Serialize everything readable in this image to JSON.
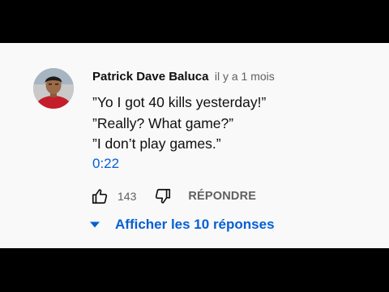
{
  "comment": {
    "author": "Patrick Dave Baluca",
    "posted_time": "il y a 1 mois",
    "lines": [
      "”Yo I got 40 kills yesterday!”",
      "”Really? What game?”",
      "”I don’t play games.”"
    ],
    "timestamp_link": "0:22",
    "like_count": "143",
    "reply_label": "RÉPONDRE",
    "show_replies_label": "Afficher les 10 réponses"
  },
  "icons": {
    "like": "thumbs-up-icon",
    "dislike": "thumbs-down-icon",
    "expand": "caret-down-icon"
  },
  "colors": {
    "link_blue": "#065fd4",
    "text_dark": "#0f0f0f",
    "text_muted": "#606060",
    "background": "#f9f9f9"
  }
}
